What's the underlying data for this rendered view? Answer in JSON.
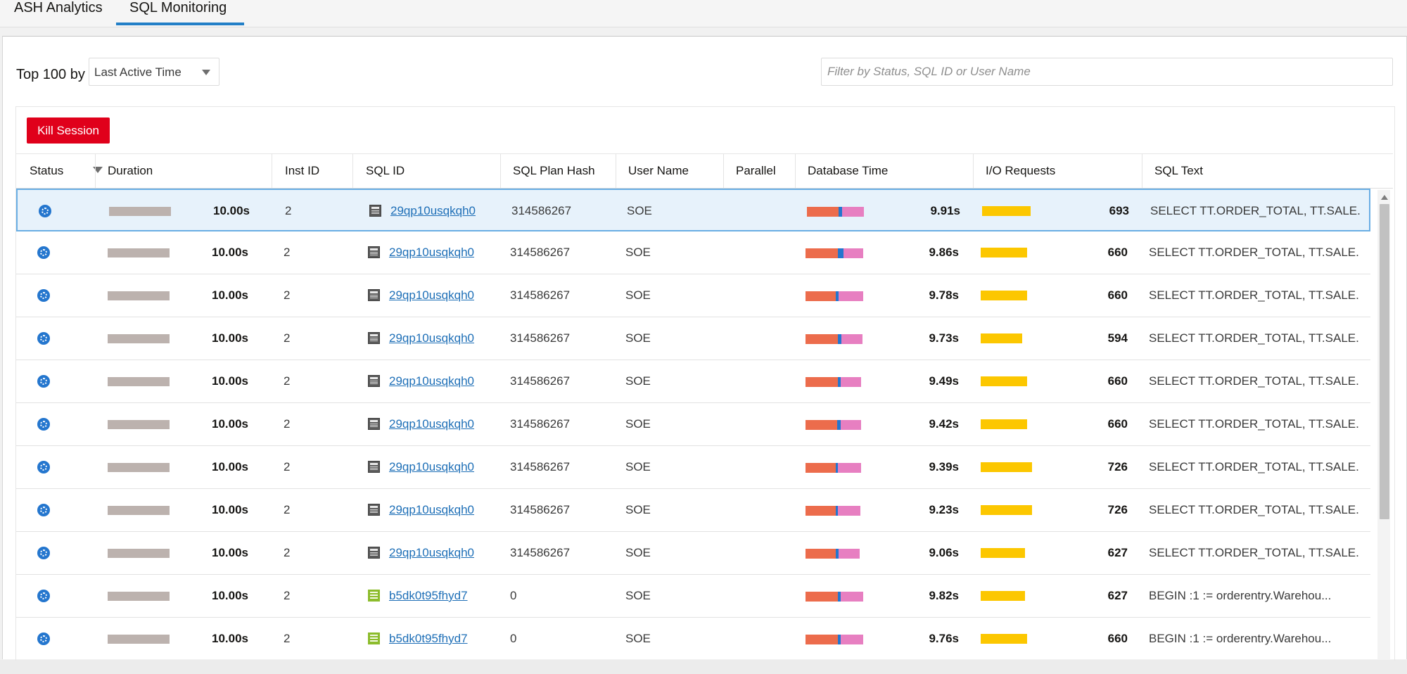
{
  "tabs": [
    {
      "label": "ASH Analytics",
      "active": false
    },
    {
      "label": "SQL Monitoring",
      "active": true
    }
  ],
  "toolbar": {
    "top_label": "Top 100 by",
    "sort_value": "Last Active Time",
    "filter_placeholder": "Filter by Status, SQL ID or User Name"
  },
  "actions": {
    "kill_session": "Kill Session"
  },
  "columns": {
    "status": "Status",
    "duration": "Duration",
    "inst_id": "Inst ID",
    "sql_id": "SQL ID",
    "sql_plan_hash": "SQL Plan Hash",
    "user_name": "User Name",
    "parallel": "Parallel",
    "database_time": "Database Time",
    "io_requests": "I/O Requests",
    "sql_text": "SQL Text"
  },
  "colors": {
    "accent": "#227fc7",
    "kill": "#e0001b",
    "cpu": "#ec6c4c",
    "io_wait": "#2476ce",
    "other_wait": "#e77fc1",
    "io_requests": "#fcc700",
    "duration_bar": "#bcb2ae"
  },
  "rows": [
    {
      "status_icon": "executing-icon",
      "duration": "10.00s",
      "duration_fraction": 1.0,
      "inst_id": "2",
      "sql_type_icon": "sql-statement-icon",
      "sql_id": "29qp10usqkqh0",
      "plan_hash": "314586267",
      "user": "SOE",
      "parallel": "",
      "db_time": "9.91s",
      "db_segments": [
        45,
        5,
        31
      ],
      "io_requests": "693",
      "io_value": 693,
      "sql_text": "SELECT TT.ORDER_TOTAL, TT.SALE...",
      "selected": true
    },
    {
      "status_icon": "executing-icon",
      "duration": "10.00s",
      "duration_fraction": 1.0,
      "inst_id": "2",
      "sql_type_icon": "sql-statement-icon",
      "sql_id": "29qp10usqkqh0",
      "plan_hash": "314586267",
      "user": "SOE",
      "parallel": "",
      "db_time": "9.86s",
      "db_segments": [
        46,
        8,
        28
      ],
      "io_requests": "660",
      "io_value": 660,
      "sql_text": "SELECT TT.ORDER_TOTAL, TT.SALE...",
      "selected": false
    },
    {
      "status_icon": "executing-icon",
      "duration": "10.00s",
      "duration_fraction": 1.0,
      "inst_id": "2",
      "sql_type_icon": "sql-statement-icon",
      "sql_id": "29qp10usqkqh0",
      "plan_hash": "314586267",
      "user": "SOE",
      "parallel": "",
      "db_time": "9.78s",
      "db_segments": [
        43,
        4,
        35
      ],
      "io_requests": "660",
      "io_value": 660,
      "sql_text": "SELECT TT.ORDER_TOTAL, TT.SALE...",
      "selected": false
    },
    {
      "status_icon": "executing-icon",
      "duration": "10.00s",
      "duration_fraction": 1.0,
      "inst_id": "2",
      "sql_type_icon": "sql-statement-icon",
      "sql_id": "29qp10usqkqh0",
      "plan_hash": "314586267",
      "user": "SOE",
      "parallel": "",
      "db_time": "9.73s",
      "db_segments": [
        46,
        5,
        30
      ],
      "io_requests": "594",
      "io_value": 594,
      "sql_text": "SELECT TT.ORDER_TOTAL, TT.SALE...",
      "selected": false
    },
    {
      "status_icon": "executing-icon",
      "duration": "10.00s",
      "duration_fraction": 1.0,
      "inst_id": "2",
      "sql_type_icon": "sql-statement-icon",
      "sql_id": "29qp10usqkqh0",
      "plan_hash": "314586267",
      "user": "SOE",
      "parallel": "",
      "db_time": "9.49s",
      "db_segments": [
        46,
        4,
        29
      ],
      "io_requests": "660",
      "io_value": 660,
      "sql_text": "SELECT TT.ORDER_TOTAL, TT.SALE...",
      "selected": false
    },
    {
      "status_icon": "executing-icon",
      "duration": "10.00s",
      "duration_fraction": 1.0,
      "inst_id": "2",
      "sql_type_icon": "sql-statement-icon",
      "sql_id": "29qp10usqkqh0",
      "plan_hash": "314586267",
      "user": "SOE",
      "parallel": "",
      "db_time": "9.42s",
      "db_segments": [
        45,
        5,
        29
      ],
      "io_requests": "660",
      "io_value": 660,
      "sql_text": "SELECT TT.ORDER_TOTAL, TT.SALE...",
      "selected": false
    },
    {
      "status_icon": "executing-icon",
      "duration": "10.00s",
      "duration_fraction": 1.0,
      "inst_id": "2",
      "sql_type_icon": "sql-statement-icon",
      "sql_id": "29qp10usqkqh0",
      "plan_hash": "314586267",
      "user": "SOE",
      "parallel": "",
      "db_time": "9.39s",
      "db_segments": [
        43,
        3,
        33
      ],
      "io_requests": "726",
      "io_value": 726,
      "sql_text": "SELECT TT.ORDER_TOTAL, TT.SALE...",
      "selected": false
    },
    {
      "status_icon": "executing-icon",
      "duration": "10.00s",
      "duration_fraction": 1.0,
      "inst_id": "2",
      "sql_type_icon": "sql-statement-icon",
      "sql_id": "29qp10usqkqh0",
      "plan_hash": "314586267",
      "user": "SOE",
      "parallel": "",
      "db_time": "9.23s",
      "db_segments": [
        43,
        3,
        32
      ],
      "io_requests": "726",
      "io_value": 726,
      "sql_text": "SELECT TT.ORDER_TOTAL, TT.SALE...",
      "selected": false
    },
    {
      "status_icon": "executing-icon",
      "duration": "10.00s",
      "duration_fraction": 1.0,
      "inst_id": "2",
      "sql_type_icon": "sql-statement-icon",
      "sql_id": "29qp10usqkqh0",
      "plan_hash": "314586267",
      "user": "SOE",
      "parallel": "",
      "db_time": "9.06s",
      "db_segments": [
        43,
        4,
        30
      ],
      "io_requests": "627",
      "io_value": 627,
      "sql_text": "SELECT TT.ORDER_TOTAL, TT.SALE...",
      "selected": false
    },
    {
      "status_icon": "executing-icon",
      "duration": "10.00s",
      "duration_fraction": 1.0,
      "inst_id": "2",
      "sql_type_icon": "plsql-block-icon",
      "sql_id": "b5dk0t95fhyd7",
      "plan_hash": "0",
      "user": "SOE",
      "parallel": "",
      "db_time": "9.82s",
      "db_segments": [
        46,
        4,
        32
      ],
      "io_requests": "627",
      "io_value": 627,
      "sql_text": "BEGIN :1 := orderentry.Warehou...",
      "selected": false
    },
    {
      "status_icon": "executing-icon",
      "duration": "10.00s",
      "duration_fraction": 1.0,
      "inst_id": "2",
      "sql_type_icon": "plsql-block-icon",
      "sql_id": "b5dk0t95fhyd7",
      "plan_hash": "0",
      "user": "SOE",
      "parallel": "",
      "db_time": "9.76s",
      "db_segments": [
        46,
        4,
        32
      ],
      "io_requests": "660",
      "io_value": 660,
      "sql_text": "BEGIN :1 := orderentry.Warehou...",
      "selected": false
    }
  ]
}
